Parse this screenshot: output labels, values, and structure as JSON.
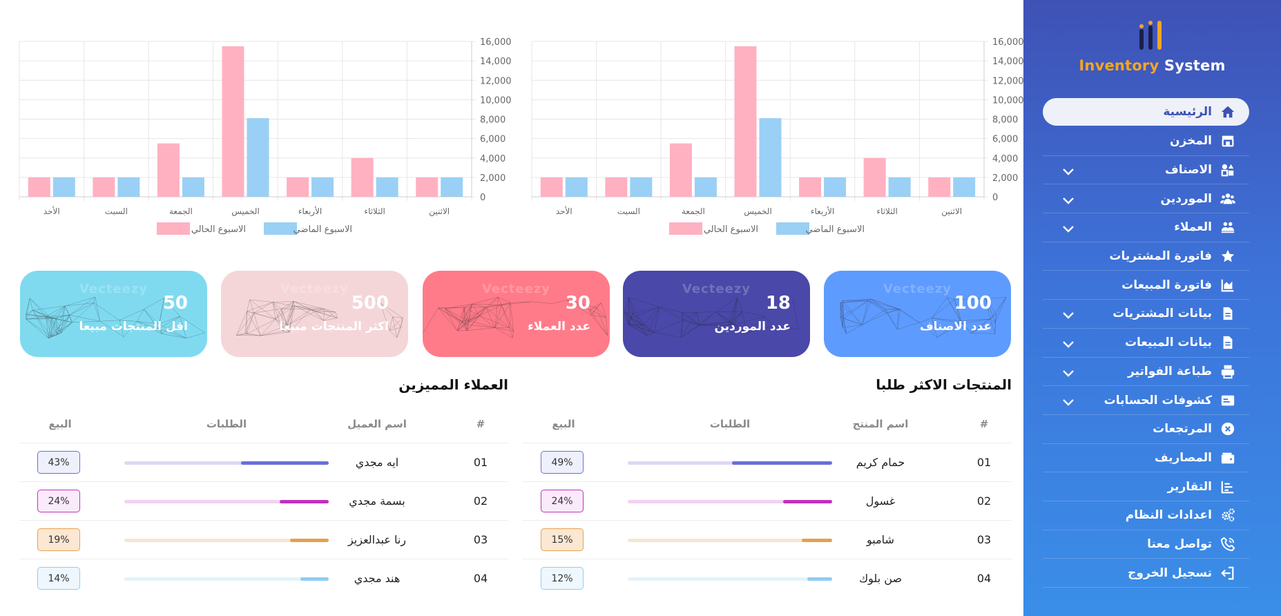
{
  "sidebar": {
    "logo": {
      "word1": "Inventory",
      "word2": "System"
    },
    "items": [
      {
        "label": "الرئيسية",
        "icon": "home-icon",
        "active": true,
        "chevron": false
      },
      {
        "label": "المخزن",
        "icon": "store-icon",
        "active": false,
        "chevron": false
      },
      {
        "label": "الاصناف",
        "icon": "shapes-icon",
        "active": false,
        "chevron": true
      },
      {
        "label": "الموردين",
        "icon": "users-icon",
        "active": false,
        "chevron": true
      },
      {
        "label": "العملاء",
        "icon": "customers-icon",
        "active": false,
        "chevron": true
      },
      {
        "label": "فاتورة المشتريات",
        "icon": "star-icon",
        "active": false,
        "chevron": false
      },
      {
        "label": "فاتورة المبيعات",
        "icon": "chart-area-icon",
        "active": false,
        "chevron": false
      },
      {
        "label": "بيانات المشتريات",
        "icon": "file-icon",
        "active": false,
        "chevron": true
      },
      {
        "label": "بيانات المبيعات",
        "icon": "file-icon",
        "active": false,
        "chevron": true
      },
      {
        "label": "طباعة الفواتير",
        "icon": "printer-icon",
        "active": false,
        "chevron": true
      },
      {
        "label": "كشوفات الحسابات",
        "icon": "id-card-icon",
        "active": false,
        "chevron": true
      },
      {
        "label": "المرتجعات",
        "icon": "cancel-circle-icon",
        "active": false,
        "chevron": false
      },
      {
        "label": "المصاريف",
        "icon": "wallet-icon",
        "active": false,
        "chevron": false
      },
      {
        "label": "التقارير",
        "icon": "report-icon",
        "active": false,
        "chevron": false
      },
      {
        "label": "اعدادات النظام",
        "icon": "gears-icon",
        "active": false,
        "chevron": false
      },
      {
        "label": "تواصل معنا",
        "icon": "phone-icon",
        "active": false,
        "chevron": false
      },
      {
        "label": "تسجيل الخروج",
        "icon": "logout-icon",
        "active": false,
        "chevron": false
      }
    ]
  },
  "chart_data": [
    {
      "type": "bar",
      "categories": [
        "الاثنين",
        "الثلاثاء",
        "الأربعاء",
        "الخميس",
        "الجمعة",
        "السبت",
        "الأحد"
      ],
      "series": [
        {
          "name": "الاسبوع الحالي",
          "color": "#ffb1c1",
          "values": [
            2000,
            4000,
            2000,
            15500,
            5500,
            2000,
            2000
          ]
        },
        {
          "name": "الاسبوع الماضي",
          "color": "#9ad0f5",
          "values": [
            2000,
            2000,
            2000,
            8100,
            2000,
            2000,
            2000
          ]
        }
      ],
      "yticks": [
        "0",
        "2,000",
        "4,000",
        "6,000",
        "8,000",
        "10,000",
        "12,000",
        "14,000",
        "16,000"
      ],
      "ylim": [
        0,
        16000
      ],
      "grid": true,
      "legend": "bottom",
      "title": "",
      "xlabel": "",
      "ylabel": ""
    },
    {
      "type": "bar",
      "categories": [
        "الاثنين",
        "الثلاثاء",
        "الأربعاء",
        "الخميس",
        "الجمعة",
        "السبت",
        "الأحد"
      ],
      "series": [
        {
          "name": "الاسبوع الحالي",
          "color": "#ffb1c1",
          "values": [
            2000,
            4000,
            2000,
            15500,
            5500,
            2000,
            2000
          ]
        },
        {
          "name": "الاسبوع الماضي",
          "color": "#9ad0f5",
          "values": [
            2000,
            2000,
            2000,
            8100,
            2000,
            2000,
            2000
          ]
        }
      ],
      "yticks": [
        "0",
        "2,000",
        "4,000",
        "6,000",
        "8,000",
        "10,000",
        "12,000",
        "14,000",
        "16,000"
      ],
      "ylim": [
        0,
        16000
      ],
      "grid": true,
      "legend": "bottom",
      "title": "",
      "xlabel": "",
      "ylabel": ""
    }
  ],
  "cards": [
    {
      "value": "100",
      "label": "عدد الاصناف",
      "color": "#5e9bff"
    },
    {
      "value": "18",
      "label": "عدد الموردين",
      "color": "#4a48a8"
    },
    {
      "value": "30",
      "label": "عدد العملاء",
      "color": "#ff7b89"
    },
    {
      "value": "500",
      "label": "اكثر المنتجات مبيعا",
      "color": "#f5d6d8"
    },
    {
      "value": "50",
      "label": "اقل المنتجات مبيعا",
      "color": "#7fdaf0"
    }
  ],
  "card_watermark": "Vecteezy",
  "tables": [
    {
      "title": "المنتجات الاكثر طلبا",
      "headers": {
        "num": "#",
        "name": "اسم المنتج",
        "bar": "الطلبات",
        "pct": "البيع"
      },
      "rows": [
        {
          "num": "01",
          "name": "حمام كريم",
          "pct": "49%",
          "fill": 0.49,
          "color": "#6a6fd8",
          "track": "#dcd8f3",
          "pctbg": "#eef0fb"
        },
        {
          "num": "02",
          "name": "غسول",
          "pct": "24%",
          "fill": 0.24,
          "color": "#c22fbd",
          "track": "#f3d2f2",
          "pctbg": "#fbeafb"
        },
        {
          "num": "03",
          "name": "شامبو",
          "pct": "15%",
          "fill": 0.15,
          "color": "#e3a24e",
          "track": "#f6e6d2",
          "pctbg": "#fbe7d2"
        },
        {
          "num": "04",
          "name": "صن بلوك",
          "pct": "12%",
          "fill": 0.12,
          "color": "#8fcdf2",
          "track": "#e4f2fb",
          "pctbg": "#eef7fd"
        }
      ]
    },
    {
      "title": "العملاء المميزين",
      "headers": {
        "num": "#",
        "name": "اسم العميل",
        "bar": "الطلبات",
        "pct": "البيع"
      },
      "rows": [
        {
          "num": "01",
          "name": "ايه مجدي",
          "pct": "43%",
          "fill": 0.43,
          "color": "#6a6fd8",
          "track": "#dcd8f3",
          "pctbg": "#eef0fb"
        },
        {
          "num": "02",
          "name": "بسمة مجدي",
          "pct": "24%",
          "fill": 0.24,
          "color": "#c22fbd",
          "track": "#f3d2f2",
          "pctbg": "#fbeafb"
        },
        {
          "num": "03",
          "name": "رنا عبدالعزيز",
          "pct": "19%",
          "fill": 0.19,
          "color": "#e3a24e",
          "track": "#f6e6d2",
          "pctbg": "#fbe7d2"
        },
        {
          "num": "04",
          "name": "هند مجدي",
          "pct": "14%",
          "fill": 0.14,
          "color": "#8fcdf2",
          "track": "#e4f2fb",
          "pctbg": "#eef7fd"
        }
      ]
    }
  ]
}
